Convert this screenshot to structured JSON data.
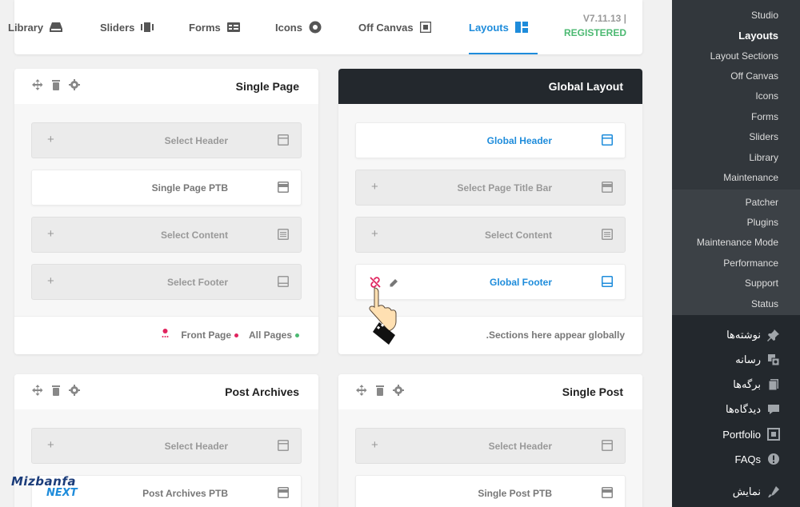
{
  "nav": {
    "tabs": [
      {
        "label": "Library",
        "icon": "library-icon"
      },
      {
        "label": "Sliders",
        "icon": "sliders-icon"
      },
      {
        "label": "Forms",
        "icon": "forms-icon"
      },
      {
        "label": "Icons",
        "icon": "icons-icon"
      },
      {
        "label": "Off Canvas",
        "icon": "off-canvas-icon"
      },
      {
        "label": "Layouts",
        "icon": "layouts-icon"
      }
    ],
    "active_tab": "Layouts",
    "version": "V7.11.13 |",
    "status": "REGISTERED"
  },
  "cards": {
    "single_page": {
      "title": "Single Page",
      "rows": [
        "Select Header",
        "Single Page PTB",
        "Select Content",
        "Select Footer"
      ],
      "footer_all": "All Pages",
      "footer_front": "Front Page"
    },
    "global_layout": {
      "title": "Global Layout",
      "rows": [
        "Global Header",
        "Select Page Title Bar",
        "Select Content",
        "Global Footer"
      ],
      "footer_note": "Sections here appear globally."
    },
    "post_archives": {
      "title": "Post Archives",
      "rows": [
        "Select Header",
        "Post Archives PTB"
      ]
    },
    "single_post": {
      "title": "Single Post",
      "rows": [
        "Select Header",
        "Single Post PTB"
      ]
    }
  },
  "sidebar": {
    "submenu": [
      "Studio",
      "Layouts",
      "Layout Sections",
      "Off Canvas",
      "Icons",
      "Forms",
      "Sliders",
      "Library",
      "Maintenance"
    ],
    "current": "Layouts",
    "submenu2": [
      "Patcher",
      "Plugins",
      "Maintenance Mode",
      "Performance",
      "Support",
      "Status"
    ],
    "menu": [
      {
        "label": "نوشته‌ها",
        "icon": "pin-icon"
      },
      {
        "label": "رسانه",
        "icon": "media-icon"
      },
      {
        "label": "برگه‌ها",
        "icon": "pages-icon"
      },
      {
        "label": "دیدگاه‌ها",
        "icon": "comments-icon"
      },
      {
        "label": "Portfolio",
        "icon": "portfolio-icon"
      },
      {
        "label": "FAQs",
        "icon": "faq-icon"
      },
      {
        "label": "نمایش",
        "icon": "appearance-icon"
      }
    ]
  },
  "logo": {
    "line1": "Mizbanfa",
    "line2": "NEXT"
  },
  "colors": {
    "accent": "#1e8cdb",
    "registered": "#4cb972",
    "sidebar": "#23282d",
    "red": "#e0245e"
  }
}
